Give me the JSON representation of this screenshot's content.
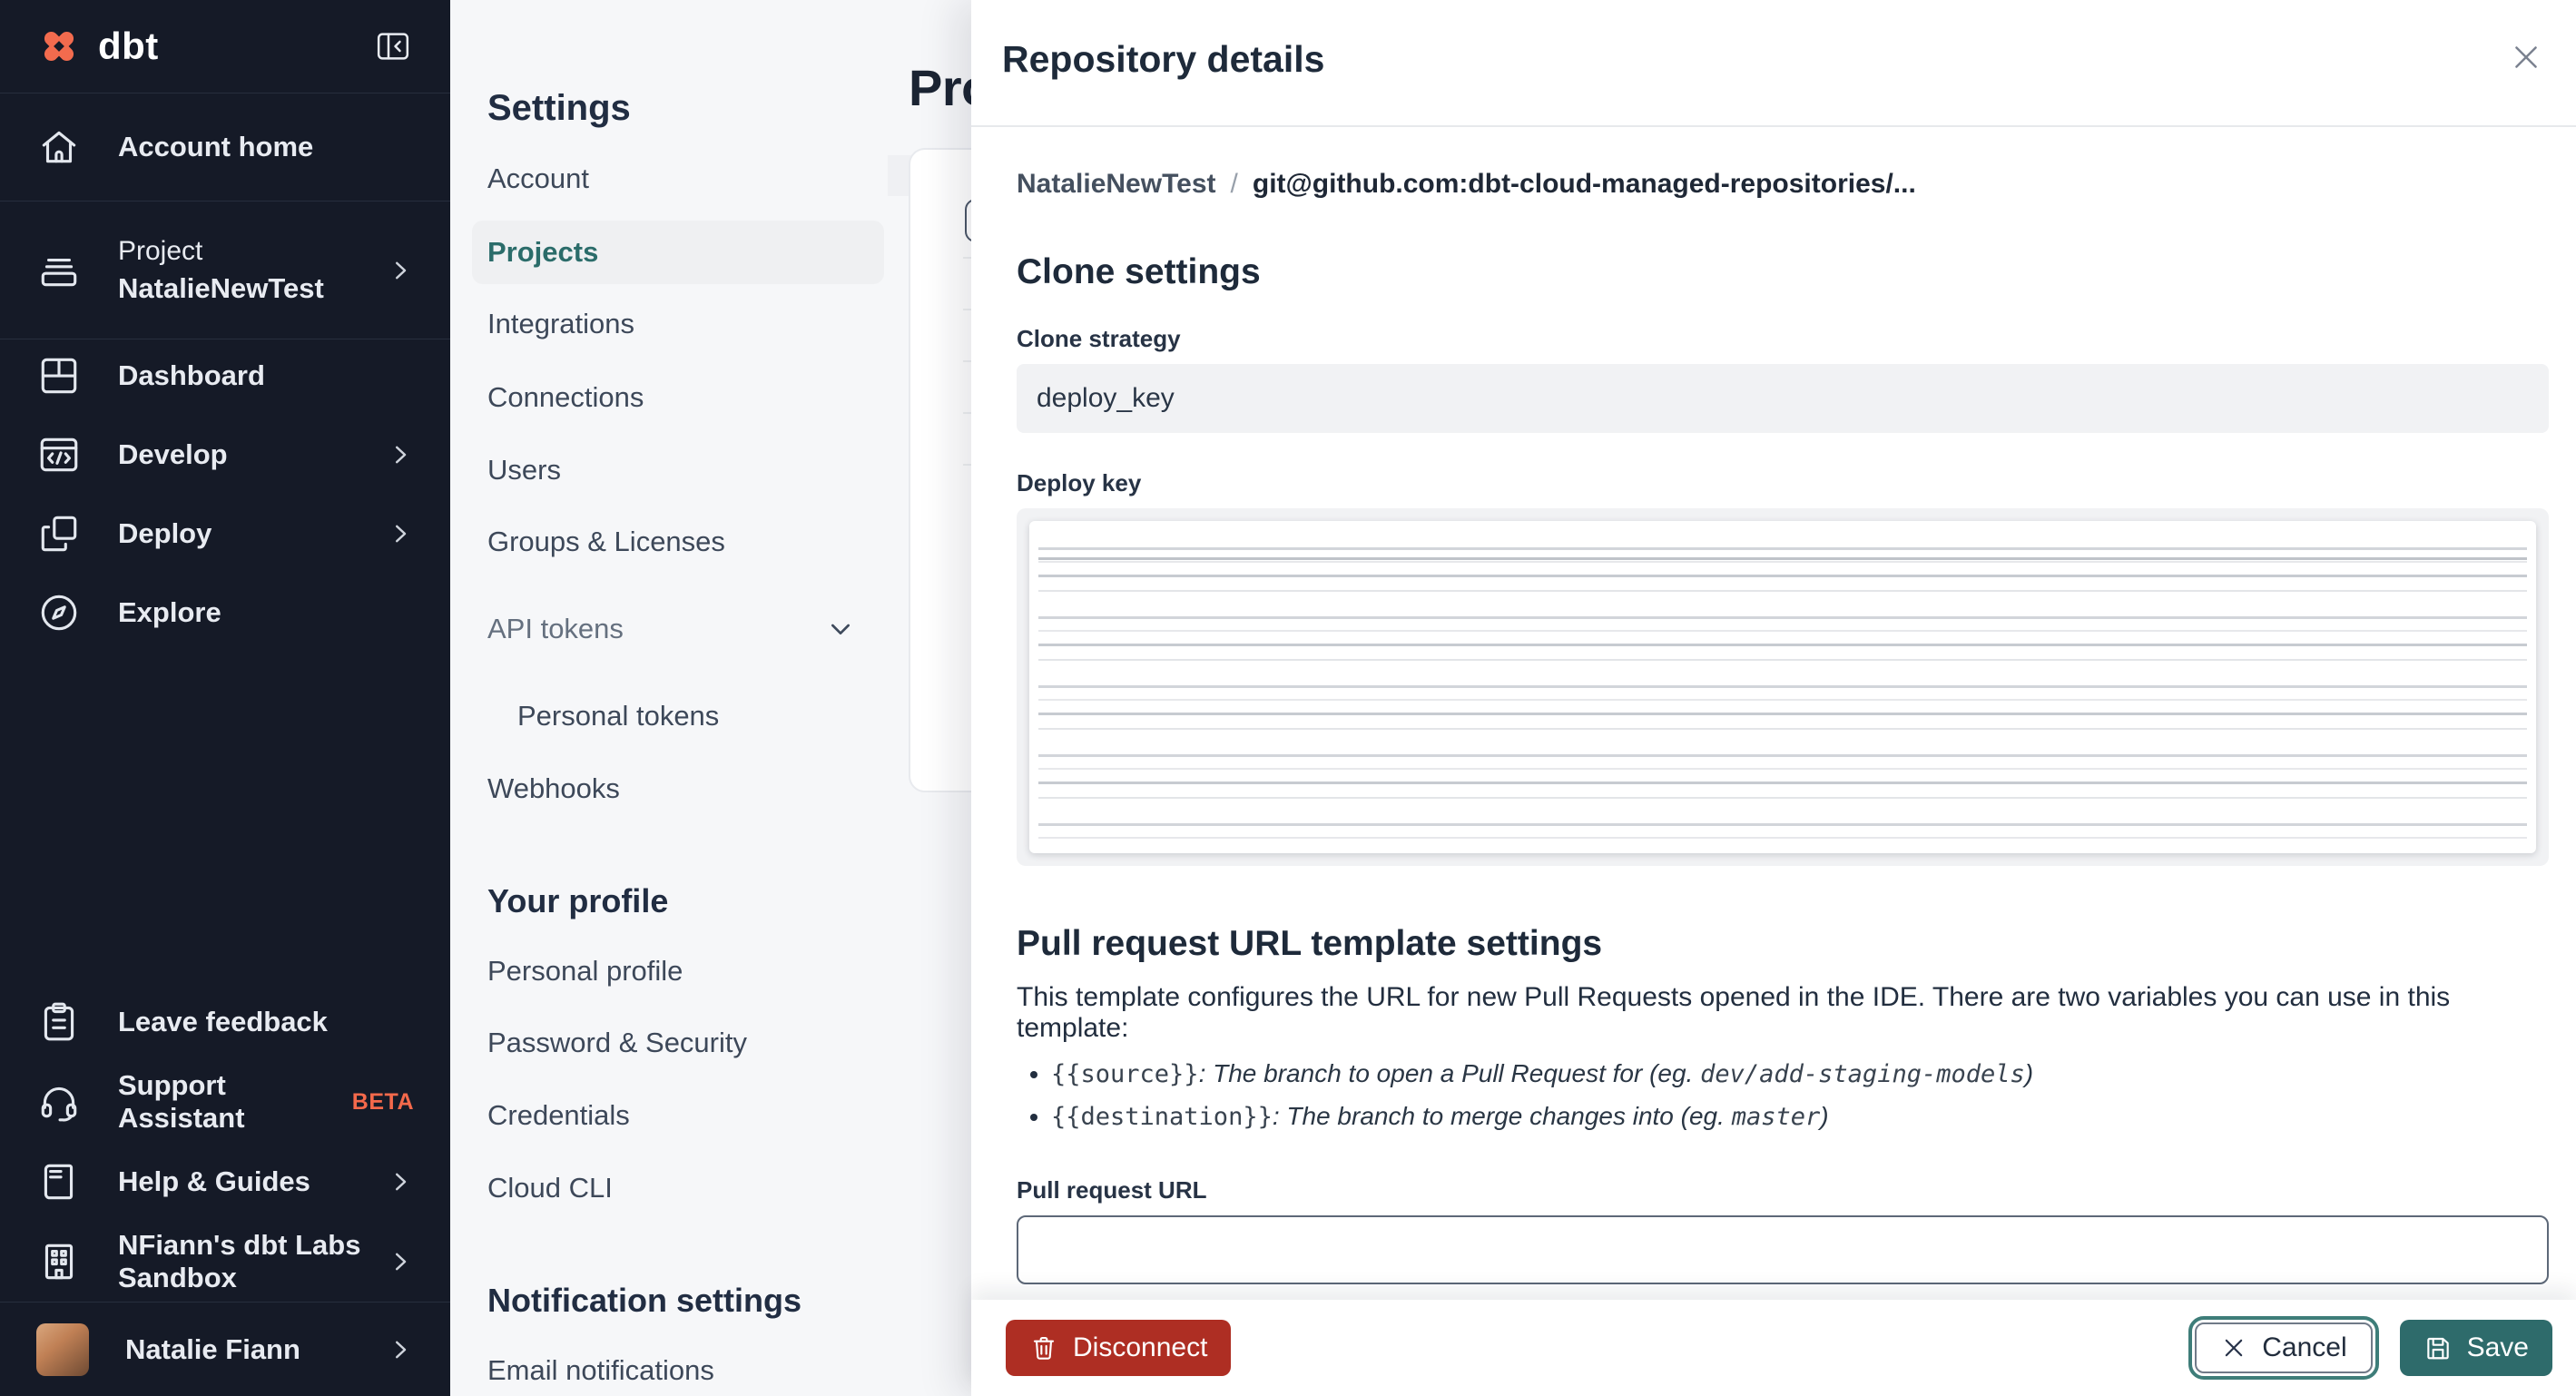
{
  "colors": {
    "sidebar_bg": "#151A27",
    "brand_orange": "#F26B4E",
    "accent_teal": "#2B6C6A",
    "danger_red": "#AE2E23",
    "save_teal": "#2E6B6B"
  },
  "sidebar": {
    "logo_text": "dbt",
    "account_home": "Account home",
    "project_label": "Project",
    "project_name": "NatalieNewTest",
    "dashboard": "Dashboard",
    "develop": "Develop",
    "deploy": "Deploy",
    "explore": "Explore",
    "leave_feedback": "Leave feedback",
    "support_assistant": "Support Assistant",
    "beta_badge": "BETA",
    "help_guides": "Help & Guides",
    "org": "NFiann's dbt Labs Sandbox",
    "user": "Natalie Fiann"
  },
  "settings_nav": {
    "title": "Settings",
    "account": "Account",
    "projects": "Projects",
    "integrations": "Integrations",
    "connections": "Connections",
    "users": "Users",
    "groups": "Groups & Licenses",
    "api_tokens": "API tokens",
    "personal_tokens": "Personal tokens",
    "webhooks": "Webhooks",
    "profile_heading": "Your profile",
    "personal_profile": "Personal profile",
    "password": "Password & Security",
    "credentials": "Credentials",
    "cloud_cli": "Cloud CLI",
    "notifications_heading": "Notification settings",
    "email_notifications": "Email notifications"
  },
  "main": {
    "title": "Projects"
  },
  "modal": {
    "title": "Repository details",
    "breadcrumb": {
      "project": "NatalieNewTest",
      "separator": "/",
      "repo": "git@github.com:dbt-cloud-managed-repositories/..."
    },
    "clone": {
      "heading": "Clone settings",
      "strategy_label": "Clone strategy",
      "strategy_value": "deploy_key",
      "deploy_key_label": "Deploy key"
    },
    "pr": {
      "heading": "Pull request URL template settings",
      "description": "This template configures the URL for new Pull Requests opened in the IDE. There are two variables you can use in this template:",
      "bullets": [
        {
          "code": "{{source}}",
          "text": ": The branch to open a Pull Request for (eg. ",
          "example": "dev/add-staging-models",
          "close": ")"
        },
        {
          "code": "{{destination}}",
          "text": ": The branch to merge changes into (eg. ",
          "example": "master",
          "close": ")"
        }
      ],
      "url_label": "Pull request URL",
      "url_value": ""
    },
    "footer": {
      "disconnect": "Disconnect",
      "cancel": "Cancel",
      "save": "Save"
    }
  }
}
